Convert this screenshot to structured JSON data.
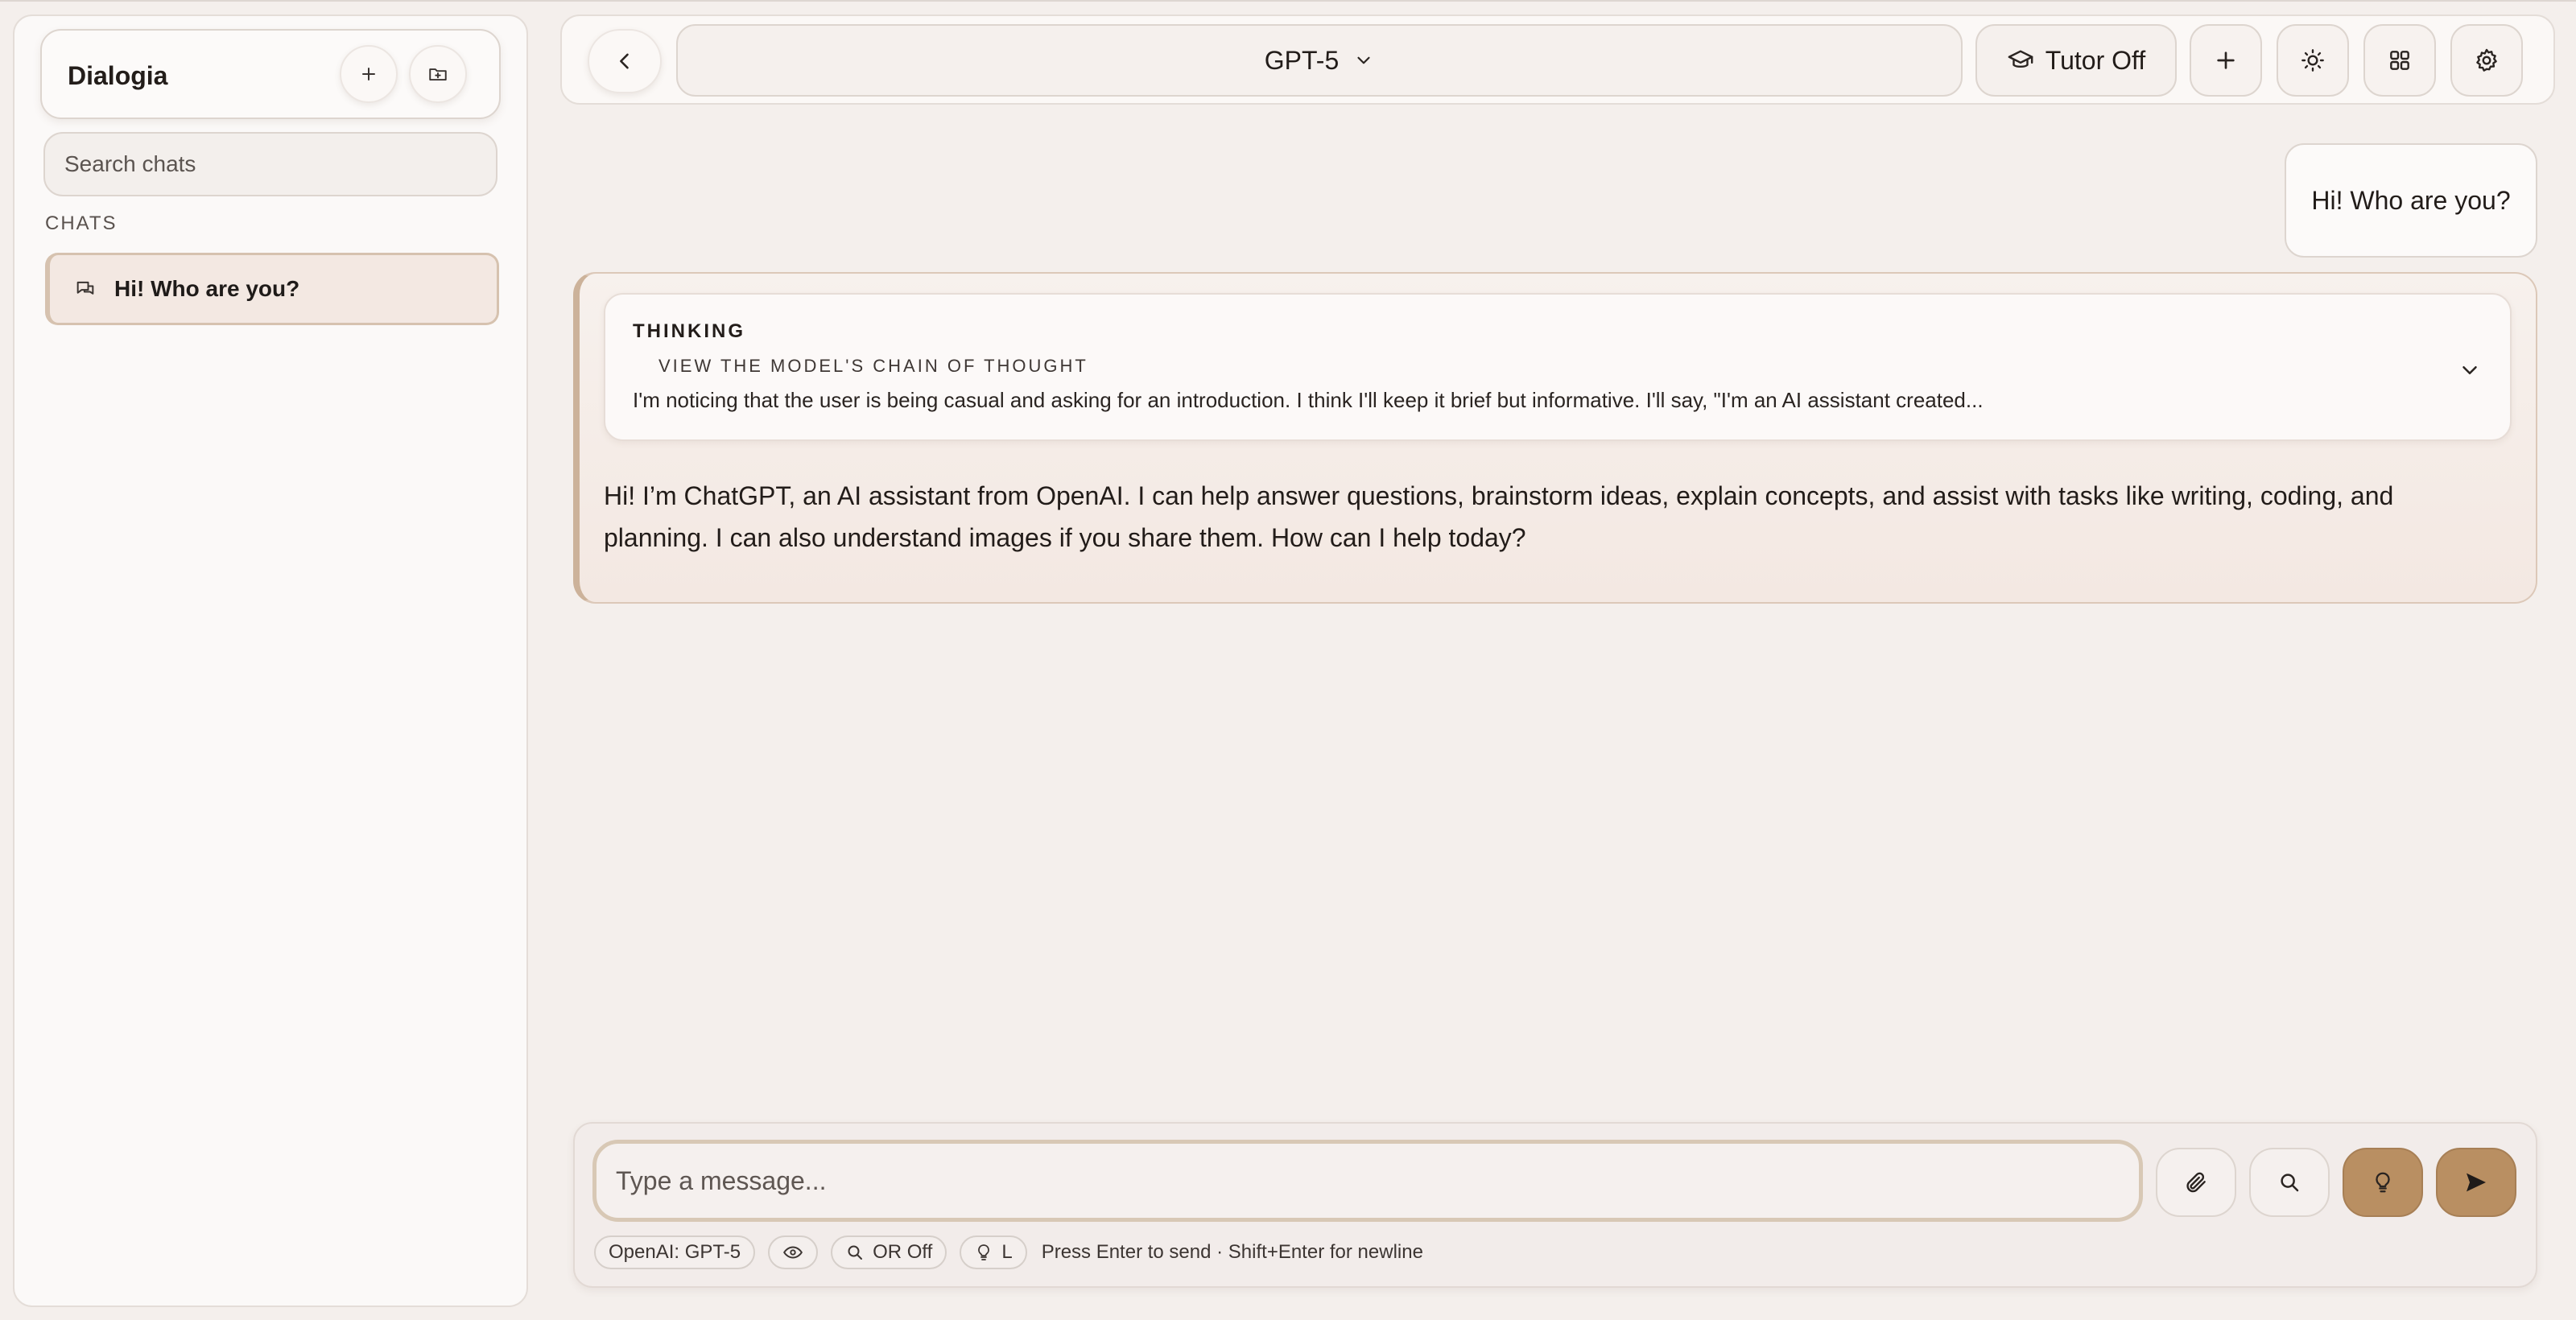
{
  "app": {
    "name": "Dialogia"
  },
  "sidebar": {
    "search_placeholder": "Search chats",
    "section_label": "CHATS",
    "chats": [
      {
        "title": "Hi! Who are you?",
        "active": true
      }
    ]
  },
  "topbar": {
    "model": "GPT-5",
    "tutor_label": "Tutor Off",
    "icons": [
      "back-icon",
      "chevron-down-icon",
      "graduation-cap-icon",
      "plus-icon",
      "sun-icon",
      "grid-icon",
      "gear-icon"
    ]
  },
  "conversation": {
    "user_message": "Hi! Who are you?",
    "thinking": {
      "title": "THINKING",
      "subtitle": "VIEW THE MODEL'S CHAIN OF THOUGHT",
      "preview": "I'm noticing that the user is being casual and asking for an introduction. I think I'll keep it brief but informative. I'll say, \"I'm an AI assistant created..."
    },
    "assistant_message": "Hi! I’m ChatGPT, an AI assistant from OpenAI. I can help answer questions, brainstorm ideas, explain concepts, and assist with tasks like writing, coding, and planning. I can also understand images if you share them. How can I help today?"
  },
  "composer": {
    "placeholder": "Type a message...",
    "chips": {
      "model": "OpenAI: GPT-5",
      "search": "OR Off",
      "reasoning": "L"
    },
    "hint": "Press Enter to send · Shift+Enter for newline"
  },
  "colors": {
    "accent": "#b98f62",
    "background": "#f4efec",
    "border": "#ddd5cf"
  }
}
